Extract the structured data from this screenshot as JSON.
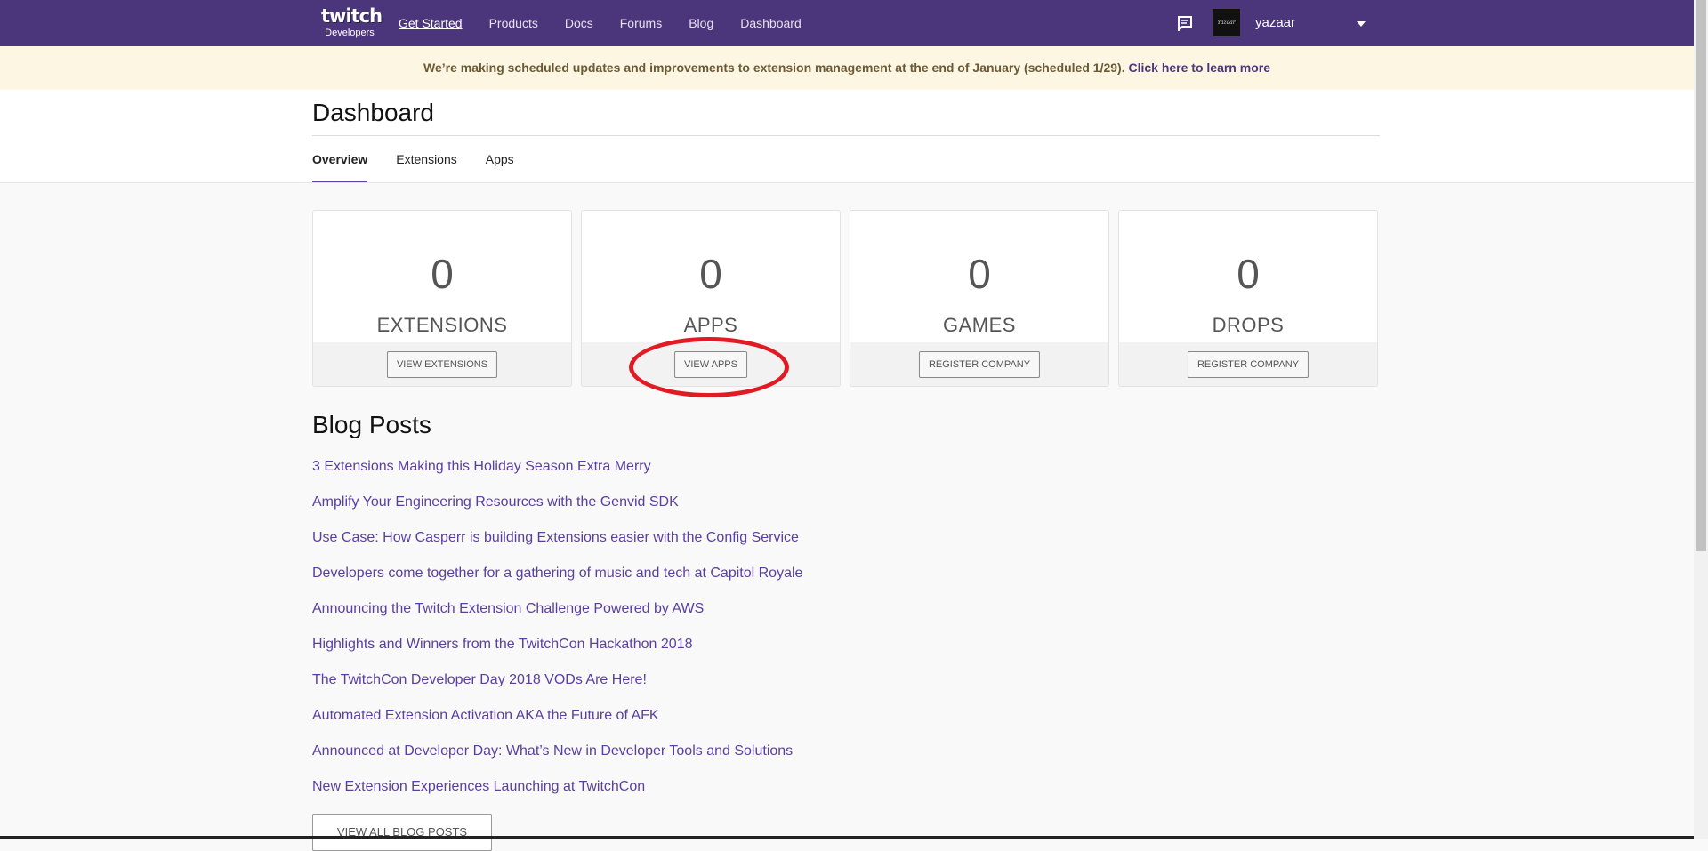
{
  "topnav": {
    "logo_word": "twitch",
    "logo_sub": "Developers",
    "links": [
      {
        "label": "Get Started",
        "active": true
      },
      {
        "label": "Products",
        "active": false
      },
      {
        "label": "Docs",
        "active": false
      },
      {
        "label": "Forums",
        "active": false
      },
      {
        "label": "Blog",
        "active": false
      },
      {
        "label": "Dashboard",
        "active": false
      }
    ],
    "message_icon": "message-icon",
    "avatar_text": "Yazaar",
    "username": "yazaar",
    "dropdown_icon": "caret-down-icon"
  },
  "banner": {
    "text": "We’re making scheduled updates and improvements to extension management at the end of January (scheduled 1/29). ",
    "link": "Click here to learn more"
  },
  "header": {
    "title": "Dashboard",
    "tabs": [
      "Overview",
      "Extensions",
      "Apps"
    ],
    "active_tab": "Overview"
  },
  "cards": [
    {
      "count": "0",
      "label": "EXTENSIONS",
      "button": "VIEW EXTENSIONS"
    },
    {
      "count": "0",
      "label": "APPS",
      "button": "VIEW APPS"
    },
    {
      "count": "0",
      "label": "GAMES",
      "button": "REGISTER COMPANY"
    },
    {
      "count": "0",
      "label": "DROPS",
      "button": "REGISTER COMPANY"
    }
  ],
  "blog": {
    "title": "Blog Posts",
    "posts": [
      "3 Extensions Making this Holiday Season Extra Merry",
      "Amplify Your Engineering Resources with the Genvid SDK",
      "Use Case: How Casperr is building Extensions easier with the Config Service",
      "Developers come together for a gathering of music and tech at Capitol Royale",
      "Announcing the Twitch Extension Challenge Powered by AWS",
      "Highlights and Winners from the TwitchCon Hackathon 2018",
      "The TwitchCon Developer Day 2018 VODs Are Here!",
      "Automated Extension Activation AKA the Future of AFK",
      "Announced at Developer Day: What’s New in Developer Tools and Solutions",
      "New Extension Experiences Launching at TwitchCon"
    ],
    "view_all": "VIEW ALL BLOG POSTS"
  },
  "colors": {
    "nav_bg": "#4b367c",
    "banner_bg": "#fcf6e3",
    "link": "#5a3fa2",
    "annotation": "#e01b24"
  }
}
